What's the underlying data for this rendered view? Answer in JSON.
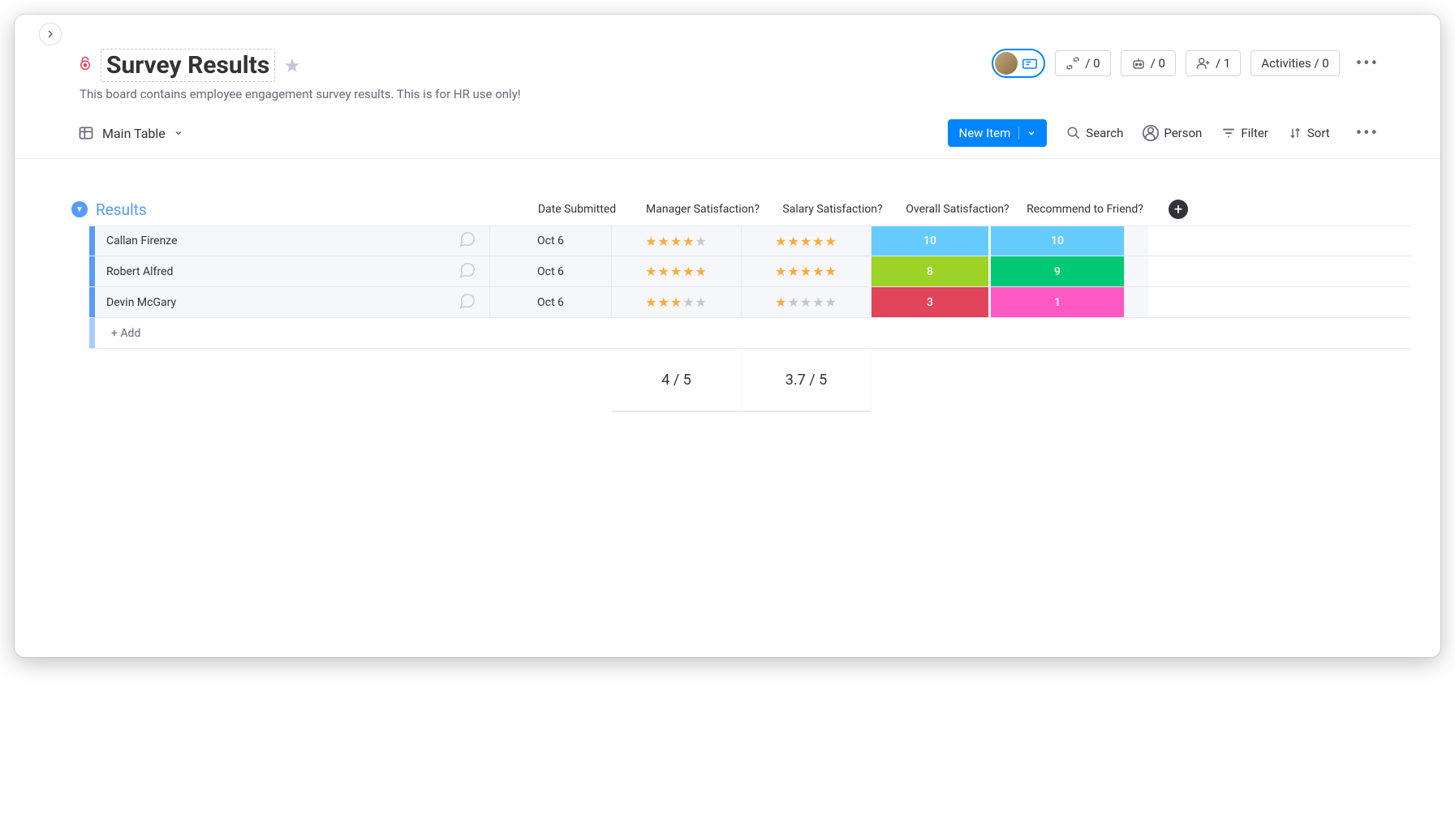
{
  "header": {
    "title": "Survey Results",
    "description": "This board contains employee engagement survey results. This is for HR use only!",
    "integrations_count": "/ 0",
    "automations_count": "/ 0",
    "members_count": "/ 1",
    "activities_label": "Activities / 0"
  },
  "toolbar": {
    "view_name": "Main Table",
    "new_item_label": "New Item",
    "search_label": "Search",
    "person_label": "Person",
    "filter_label": "Filter",
    "sort_label": "Sort"
  },
  "group": {
    "name": "Results",
    "columns": {
      "date": "Date Submitted",
      "manager": "Manager Satisfaction?",
      "salary": "Salary Satisfaction?",
      "overall": "Overall Satisfaction?",
      "recommend": "Recommend to Friend?"
    },
    "rows": [
      {
        "name": "Callan Firenze",
        "date": "Oct 6",
        "manager_stars": 4,
        "salary_stars": 5,
        "overall": "10",
        "overall_color": "bg-blue",
        "recommend": "10",
        "recommend_color": "bg-blue"
      },
      {
        "name": "Robert Alfred",
        "date": "Oct 6",
        "manager_stars": 5,
        "salary_stars": 5,
        "overall": "8",
        "overall_color": "bg-green",
        "recommend": "9",
        "recommend_color": "bg-teal"
      },
      {
        "name": "Devin McGary",
        "date": "Oct 6",
        "manager_stars": 3,
        "salary_stars": 1,
        "overall": "3",
        "overall_color": "bg-pink",
        "recommend": "1",
        "recommend_color": "bg-magenta"
      }
    ],
    "add_label": "+ Add",
    "footer": {
      "manager_avg": "4  / 5",
      "salary_avg": "3.7  / 5"
    }
  }
}
